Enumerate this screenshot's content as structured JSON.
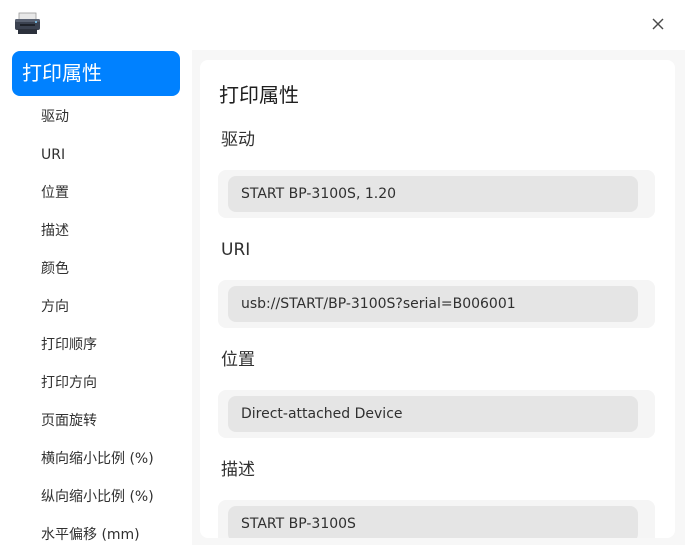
{
  "titlebar": {
    "app_icon": "printer-icon",
    "close_icon": "close-icon"
  },
  "sidebar": {
    "active_label": "打印属性",
    "items": [
      {
        "label": "驱动"
      },
      {
        "label": "URI"
      },
      {
        "label": "位置"
      },
      {
        "label": "描述"
      },
      {
        "label": "颜色"
      },
      {
        "label": "方向"
      },
      {
        "label": "打印顺序"
      },
      {
        "label": "打印方向"
      },
      {
        "label": "页面旋转"
      },
      {
        "label": "横向缩小比例 (%)"
      },
      {
        "label": "纵向缩小比例 (%)"
      },
      {
        "label": "水平偏移 (mm)"
      }
    ]
  },
  "main": {
    "title": "打印属性",
    "fields": [
      {
        "label": "驱动",
        "value": "START BP-3100S, 1.20"
      },
      {
        "label": "URI",
        "value": "usb://START/BP-3100S?serial=B006001"
      },
      {
        "label": "位置",
        "value": "Direct-attached Device"
      },
      {
        "label": "描述",
        "value": "START BP-3100S"
      }
    ]
  },
  "colors": {
    "accent": "#0081ff",
    "window_bg": "#f7f7f7",
    "field_bg": "#e5e5e5"
  }
}
